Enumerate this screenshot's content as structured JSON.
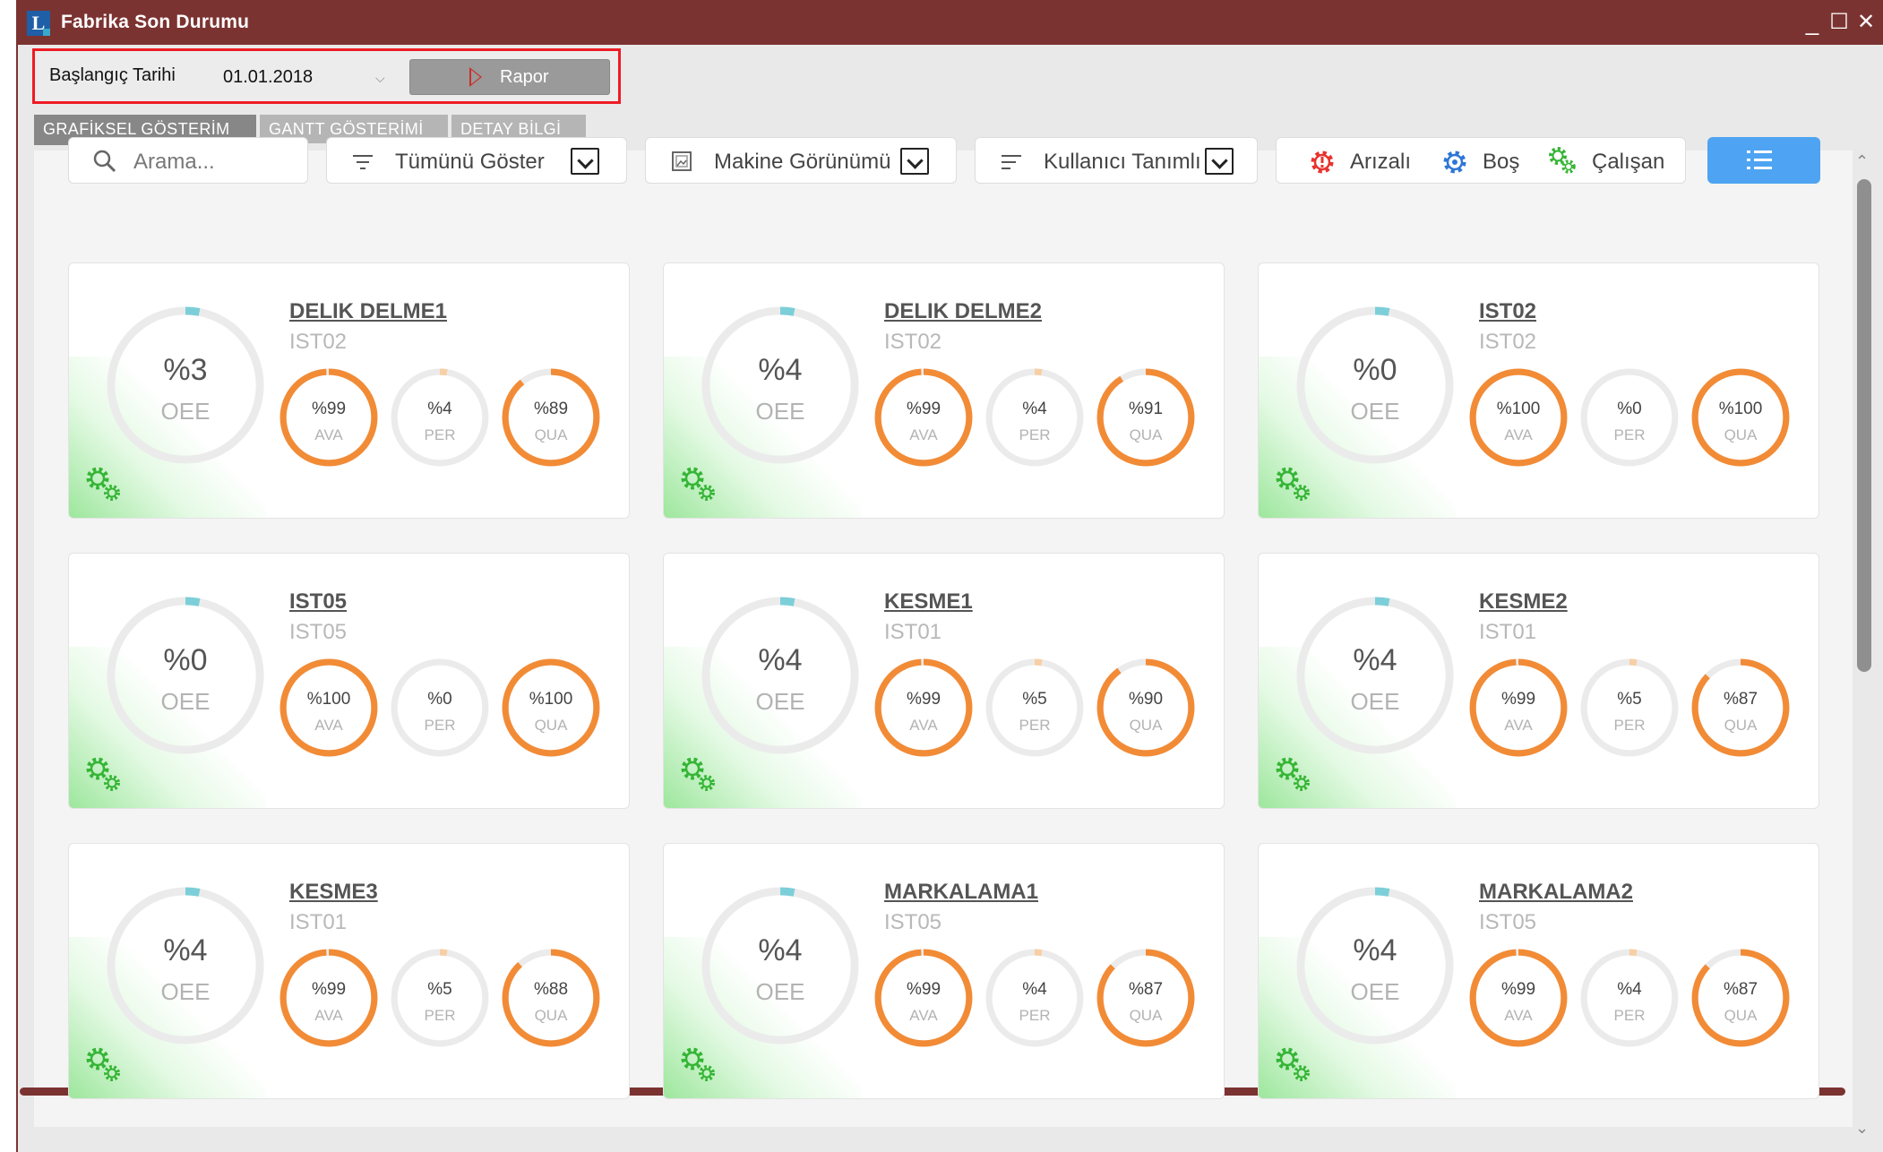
{
  "window": {
    "title": "Fabrika Son Durumu",
    "controls": {
      "minimize": "_",
      "maximize": "☐",
      "close": "✕"
    }
  },
  "toolbar": {
    "start_date_label": "Başlangıç Tarihi",
    "start_date_value": "01.01.2018",
    "report_button": "Rapor"
  },
  "tabs": [
    {
      "label": "GRAFİKSEL GÖSTERİM",
      "active": true
    },
    {
      "label": "GANTT GÖSTERİMİ",
      "active": false
    },
    {
      "label": "DETAY BİLGİ",
      "active": false
    }
  ],
  "filters": {
    "search_placeholder": "Arama...",
    "show_filter": "Tümünü Göster",
    "view_filter": "Makine Görünümü",
    "sort_filter": "Kullanıcı Tanımlı"
  },
  "status_legend": {
    "faulty": "Arızalı",
    "idle": "Boş",
    "running": "Çalışan"
  },
  "colors": {
    "title_bar": "#7b3331",
    "accent_blue": "#4ea4f2",
    "gauge_orange": "#f28b36",
    "gauge_teal": "#7ccfd8",
    "gauge_peach": "#f8cfa5",
    "running_green": "#35b535",
    "faulty_red": "#e8332f"
  },
  "machines": [
    {
      "name": "DELIK DELME1",
      "code": "IST02",
      "oee": "%3",
      "oee_label": "OEE",
      "ava": "%99",
      "per": "%4",
      "qua": "%89",
      "oee_pct": 3,
      "ava_pct": 99,
      "per_pct": 4,
      "qua_pct": 89
    },
    {
      "name": "DELIK DELME2",
      "code": "IST02",
      "oee": "%4",
      "oee_label": "OEE",
      "ava": "%99",
      "per": "%4",
      "qua": "%91",
      "oee_pct": 4,
      "ava_pct": 99,
      "per_pct": 4,
      "qua_pct": 91
    },
    {
      "name": "IST02",
      "code": "IST02",
      "oee": "%0",
      "oee_label": "OEE",
      "ava": "%100",
      "per": "%0",
      "qua": "%100",
      "oee_pct": 0,
      "ava_pct": 100,
      "per_pct": 0,
      "qua_pct": 100
    },
    {
      "name": "IST05",
      "code": "IST05",
      "oee": "%0",
      "oee_label": "OEE",
      "ava": "%100",
      "per": "%0",
      "qua": "%100",
      "oee_pct": 0,
      "ava_pct": 100,
      "per_pct": 0,
      "qua_pct": 100
    },
    {
      "name": "KESME1",
      "code": "IST01",
      "oee": "%4",
      "oee_label": "OEE",
      "ava": "%99",
      "per": "%5",
      "qua": "%90",
      "oee_pct": 4,
      "ava_pct": 99,
      "per_pct": 5,
      "qua_pct": 90
    },
    {
      "name": "KESME2",
      "code": "IST01",
      "oee": "%4",
      "oee_label": "OEE",
      "ava": "%99",
      "per": "%5",
      "qua": "%87",
      "oee_pct": 4,
      "ava_pct": 99,
      "per_pct": 5,
      "qua_pct": 87
    },
    {
      "name": "KESME3",
      "code": "IST01",
      "oee": "%4",
      "oee_label": "OEE",
      "ava": "%99",
      "per": "%5",
      "qua": "%88",
      "oee_pct": 4,
      "ava_pct": 99,
      "per_pct": 5,
      "qua_pct": 88
    },
    {
      "name": "MARKALAMA1",
      "code": "IST05",
      "oee": "%4",
      "oee_label": "OEE",
      "ava": "%99",
      "per": "%4",
      "qua": "%87",
      "oee_pct": 4,
      "ava_pct": 99,
      "per_pct": 4,
      "qua_pct": 87
    },
    {
      "name": "MARKALAMA2",
      "code": "IST05",
      "oee": "%4",
      "oee_label": "OEE",
      "ava": "%99",
      "per": "%4",
      "qua": "%87",
      "oee_pct": 4,
      "ava_pct": 99,
      "per_pct": 4,
      "qua_pct": 87
    }
  ],
  "gauge_labels": {
    "ava": "AVA",
    "per": "PER",
    "qua": "QUA"
  }
}
